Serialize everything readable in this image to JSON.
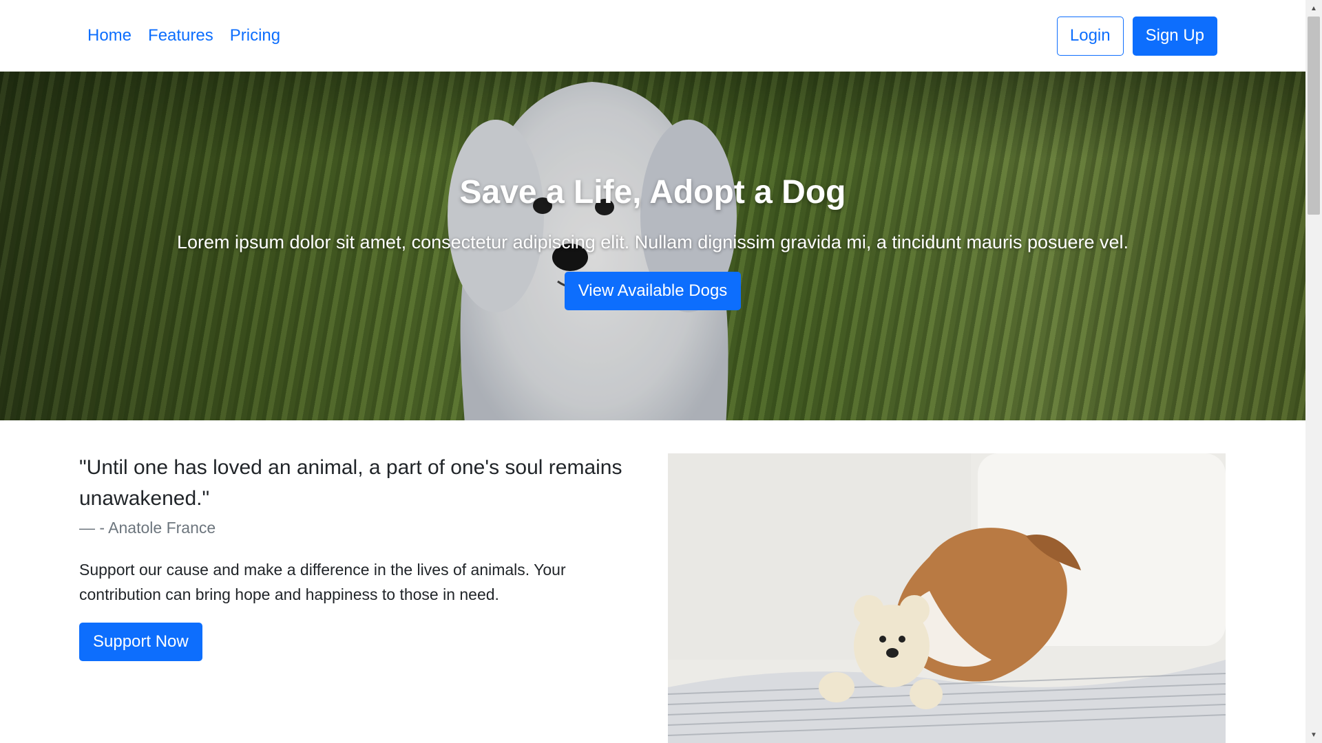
{
  "nav": {
    "links": [
      "Home",
      "Features",
      "Pricing"
    ],
    "login_label": "Login",
    "signup_label": "Sign Up"
  },
  "hero": {
    "title": "Save a Life, Adopt a Dog",
    "text": "Lorem ipsum dolor sit amet, consectetur adipiscing elit. Nullam dignissim gravida mi, a tincidunt mauris posuere vel.",
    "button_label": "View Available Dogs"
  },
  "content": {
    "quote": "\"Until one has loved an animal, a part of one's soul remains unawakened.\"",
    "author": "— - Anatole France",
    "support_text": "Support our cause and make a difference in the lives of animals. Your contribution can bring hope and happiness to those in need.",
    "support_button_label": "Support Now"
  },
  "colors": {
    "primary": "#0d6efd",
    "muted": "#6c757d"
  }
}
